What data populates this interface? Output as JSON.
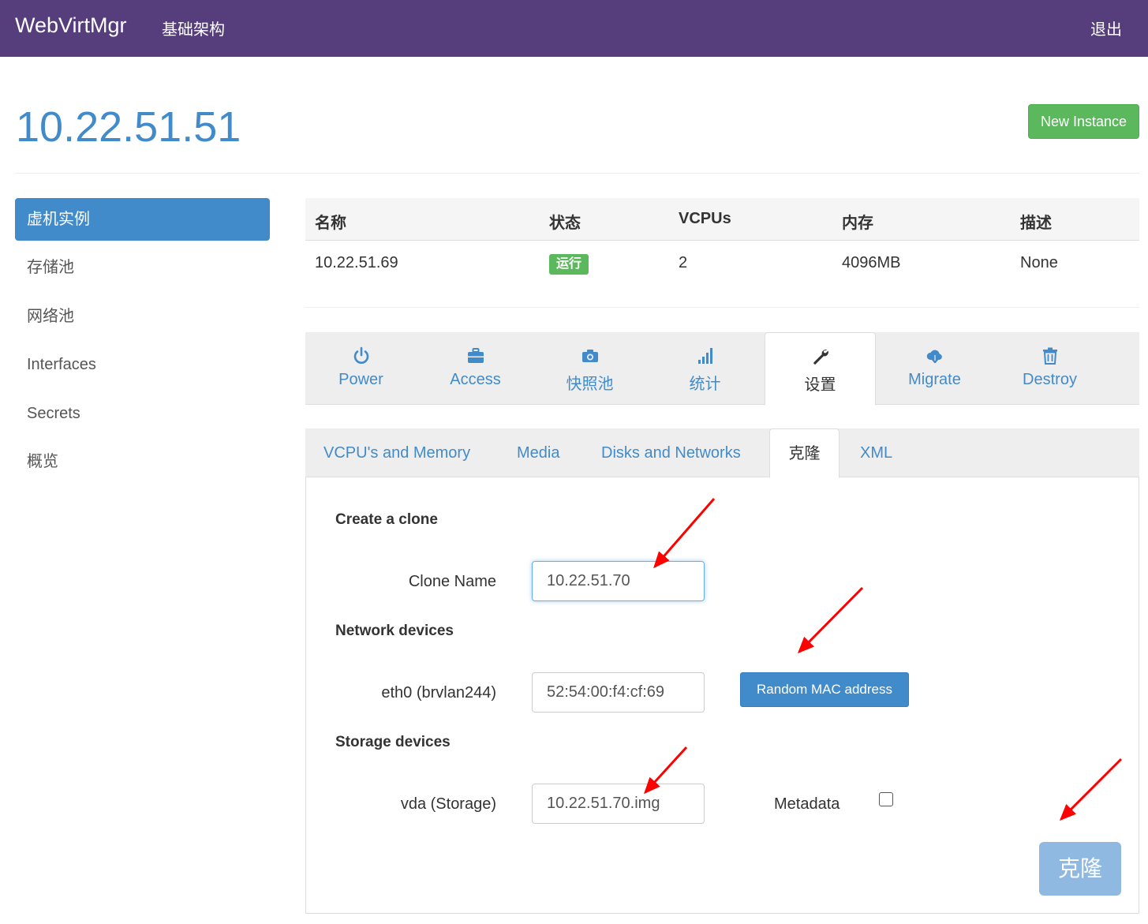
{
  "navbar": {
    "brand": "WebVirtMgr",
    "infrastructure_link": "基础架构",
    "logout": "退出"
  },
  "header": {
    "host": "10.22.51.51",
    "new_instance": "New Instance"
  },
  "sidebar": {
    "items": [
      {
        "label": "虚机实例",
        "active": true
      },
      {
        "label": "存储池"
      },
      {
        "label": "网络池"
      },
      {
        "label": "Interfaces"
      },
      {
        "label": "Secrets"
      },
      {
        "label": "概览"
      }
    ]
  },
  "instance_table": {
    "headers": [
      "名称",
      "状态",
      "VCPUs",
      "内存",
      "描述"
    ],
    "row": {
      "name": "10.22.51.69",
      "status": "运行",
      "vcpus": "2",
      "memory": "4096MB",
      "description": "None"
    }
  },
  "action_tabs": [
    {
      "label": "Power",
      "icon": "power-icon"
    },
    {
      "label": "Access",
      "icon": "briefcase-icon"
    },
    {
      "label": "快照池",
      "icon": "camera-icon"
    },
    {
      "label": "统计",
      "icon": "signal-bars-icon"
    },
    {
      "label": "设置",
      "icon": "wrench-icon",
      "active": true
    },
    {
      "label": "Migrate",
      "icon": "cloud-download-icon"
    },
    {
      "label": "Destroy",
      "icon": "trash-icon"
    }
  ],
  "settings_tabs": [
    {
      "label": "VCPU's and Memory"
    },
    {
      "label": "Media"
    },
    {
      "label": "Disks and Networks"
    },
    {
      "label": "克隆",
      "active": true
    },
    {
      "label": "XML"
    }
  ],
  "clone_form": {
    "title": "Create a clone",
    "clone_name_label": "Clone Name",
    "clone_name_value": "10.22.51.70",
    "network_heading": "Network devices",
    "eth0_label": "eth0 (brvlan244)",
    "eth0_mac": "52:54:00:f4:cf:69",
    "random_mac_button": "Random MAC address",
    "storage_heading": "Storage devices",
    "vda_label": "vda (Storage)",
    "vda_value": "10.22.51.70.img",
    "metadata_label": "Metadata",
    "metadata_checked": false,
    "clone_button": "克隆"
  },
  "colors": {
    "navbar": "#563d7c",
    "primary": "#428bca",
    "success": "#5cb85c",
    "annotation": "#ff0000"
  }
}
